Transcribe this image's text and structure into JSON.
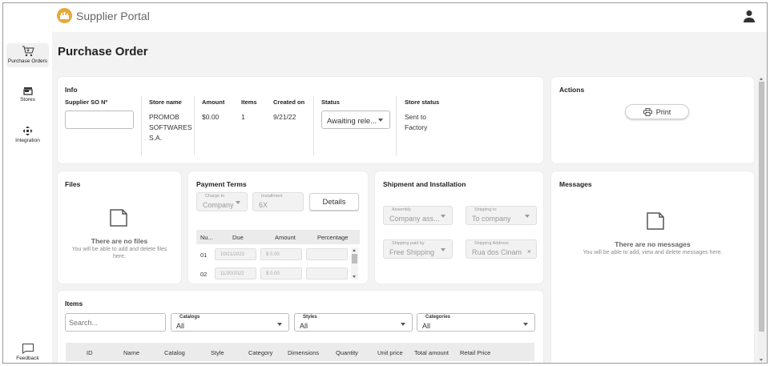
{
  "app": {
    "name": "Supplier Portal"
  },
  "sidebar": {
    "items": [
      {
        "label": "Purchase Orders",
        "icon": "cart-icon"
      },
      {
        "label": "Stores",
        "icon": "store-icon"
      },
      {
        "label": "Integration",
        "icon": "integration-icon"
      }
    ],
    "feedback": {
      "label": "Feedback",
      "icon": "feedback-icon"
    }
  },
  "page": {
    "title": "Purchase Order"
  },
  "info": {
    "title": "Info",
    "supplier_so_label": "Supplier SO Nº",
    "supplier_so_value": "",
    "store_name_label": "Store name",
    "store_name_value": "PROMOB SOFTWARES S.A.",
    "amount_label": "Amount",
    "amount_value": "$0.00",
    "items_label": "Items",
    "items_value": "1",
    "created_label": "Created on",
    "created_value": "9/21/22",
    "status_label": "Status",
    "status_value": "Awaiting rele...",
    "store_status_label": "Store status",
    "store_status_value": "Sent to Factory"
  },
  "actions": {
    "title": "Actions",
    "print_label": "Print"
  },
  "files": {
    "title": "Files",
    "empty_title": "There are no files",
    "empty_sub": "You will be able to add and delete files here."
  },
  "payment": {
    "title": "Payment Terms",
    "charge_to_label": "Charge to",
    "charge_to_value": "Company",
    "installment_label": "Installment",
    "installment_value": "6X",
    "details_label": "Details",
    "columns": [
      "Nu...",
      "Due",
      "Amount",
      "Percentage"
    ],
    "rows": [
      {
        "num": "01",
        "due": "10/21/2022",
        "amount": "$ 0.00",
        "percent": ""
      },
      {
        "num": "02",
        "due": "11/20/2022",
        "amount": "$ 0.00",
        "percent": ""
      }
    ]
  },
  "shipment": {
    "title": "Shipment and Installation",
    "assembly_label": "Assembly",
    "assembly_value": "Company ass...",
    "shipping_to_label": "Shipping to",
    "shipping_to_value": "To company",
    "shipping_paid_label": "Shipping paid by",
    "shipping_paid_value": "Free Shipping",
    "shipping_address_label": "Shipping Address",
    "shipping_address_value": "Rua dos Cinamo"
  },
  "messages": {
    "title": "Messages",
    "empty_title": "There are no messages",
    "empty_sub": "You will be able to add, view and delete messages here."
  },
  "items": {
    "title": "Items",
    "search_placeholder": "Search...",
    "catalogs_label": "Catalogs",
    "catalogs_value": "All",
    "styles_label": "Styles",
    "styles_value": "All",
    "categories_label": "Categories",
    "categories_value": "All",
    "columns": [
      "ID",
      "Name",
      "Catalog",
      "Style",
      "Category",
      "Dimensions",
      "Quantity",
      "Unit price",
      "Total amount",
      "Retail Price"
    ]
  },
  "colors": {
    "logo": "#e6a93a",
    "background": "#f3f3f3",
    "card": "#ffffff"
  }
}
